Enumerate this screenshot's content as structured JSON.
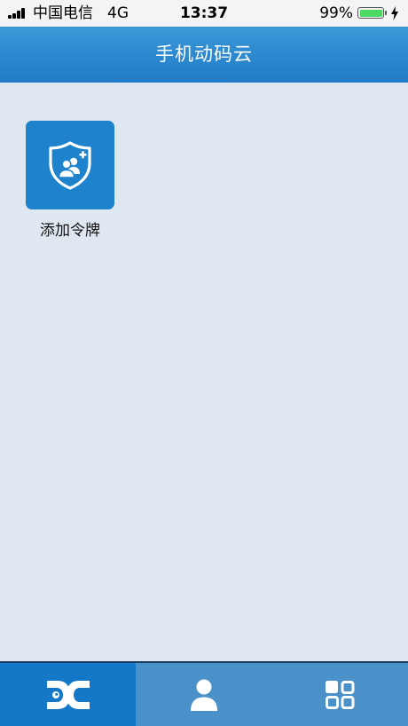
{
  "status_bar": {
    "carrier": "中国电信",
    "network": "4G",
    "time": "13:37",
    "battery_percent": "99%",
    "battery_color": "#4cd964"
  },
  "header": {
    "title": "手机动码云"
  },
  "tiles": [
    {
      "label": "添加令牌",
      "icon": "shield-add-user-icon"
    }
  ],
  "tab_bar": {
    "active_index": 0,
    "tabs": [
      {
        "icon": "dc-logo-icon"
      },
      {
        "icon": "user-icon"
      },
      {
        "icon": "grid-apps-icon"
      }
    ]
  },
  "colors": {
    "header_blue": "#2d89cf",
    "tile_blue": "#1f82cc",
    "tab_active": "#1478c8",
    "tab_inactive": "#4a90c9",
    "background": "#dfe7f0"
  }
}
